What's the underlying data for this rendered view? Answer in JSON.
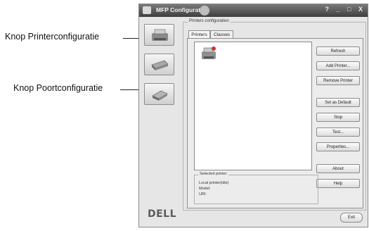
{
  "callouts": {
    "printer_config": "Knop Printerconfiguratie",
    "port_config": "Knop Poortconfiguratie"
  },
  "window": {
    "title": "MFP Configurator",
    "controls": "? _ □ X"
  },
  "sidebar": {
    "icons": [
      "printer-icon",
      "scanner-icon",
      "port-icon"
    ]
  },
  "brand": {
    "logo": "DELL"
  },
  "printers_configuration": {
    "group_label": "Printers configuration",
    "tabs": [
      "Printers",
      "Classes"
    ],
    "active_tab": "Printers",
    "buttons": {
      "refresh": "Refresh",
      "add_printer": "Add Printer...",
      "remove_printer": "Remove Printer",
      "set_as_default": "Set as Default",
      "stop": "Stop",
      "test": "Test...",
      "properties": "Properties...",
      "about": "About",
      "help": "Help"
    },
    "selected_printer": {
      "label": "Selected printer",
      "line1": "Local printer(idle)",
      "line2": "Model:",
      "line3": "URI:"
    }
  },
  "exit_label": "Exit",
  "colors": {
    "window_bg": "#e6e6e6",
    "titlebar_top": "#7a7a7a",
    "titlebar_bottom": "#3e3e3e",
    "list_bg": "#ffffff"
  }
}
